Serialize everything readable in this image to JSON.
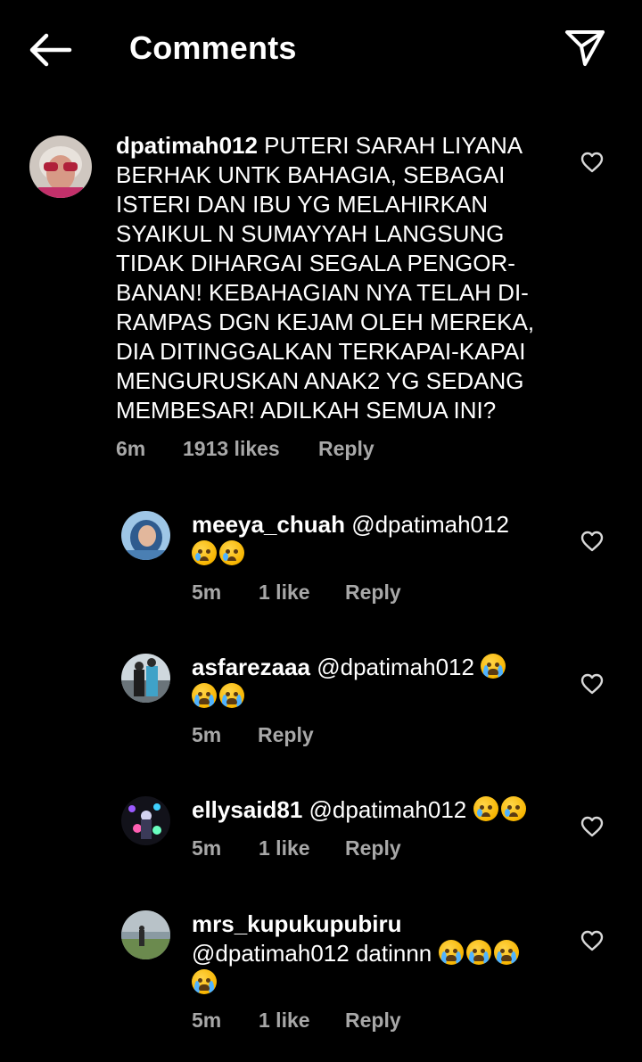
{
  "header": {
    "title": "Comments"
  },
  "comments": [
    {
      "username": "dpatimah012",
      "text": " PUTERI SARAH LIYANA BERHAK UNTK BAHAGIA, SEBAGAI ISTERI DAN IBU YG MELAHIRKAN SYAIKUL N SUMAYYAH LANGSUNG TIDAK DIHARGAI SEGALA PENGOR-BANAN! KEBAHAGIAN NYA TELAH DI-RAMPAS DGN KEJAM OLEH MEREKA, DIA DITINGGALKAN TERKAPAI-KAPAI MENGURUSKAN ANAK2 YG SEDANG MEMBESAR! ADILKAH SEMUA INI?",
      "time": "6m",
      "likes": "1913 likes",
      "reply": "Reply"
    }
  ],
  "replies": [
    {
      "username": "meeya_chuah",
      "mention": " @dpatimah012",
      "emoji": [
        "crying",
        "crying"
      ],
      "time": "5m",
      "likes": "1 like",
      "reply": "Reply"
    },
    {
      "username": "asfarezaaa",
      "mention": " @dpatimah012",
      "emoji": [
        "loudly-crying",
        "loudly-crying",
        "loudly-crying"
      ],
      "time": "5m",
      "likes": "",
      "reply": "Reply"
    },
    {
      "username": "ellysaid81",
      "mention": " @dpatimah012",
      "emoji": [
        "crying",
        "crying"
      ],
      "time": "5m",
      "likes": "1 like",
      "reply": "Reply"
    },
    {
      "username": "mrs_kupukupubiru",
      "mention": "@dpatimah012 datinnn",
      "emoji": [
        "loudly-crying",
        "loudly-crying",
        "loudly-crying",
        "loudly-crying"
      ],
      "time": "5m",
      "likes": "1 like",
      "reply": "Reply"
    }
  ],
  "icons": {
    "back": "arrow-left-icon",
    "send": "send-icon",
    "like": "heart-icon"
  },
  "colors": {
    "background": "#000000",
    "text": "#ffffff",
    "meta": "#a8a8a8"
  }
}
